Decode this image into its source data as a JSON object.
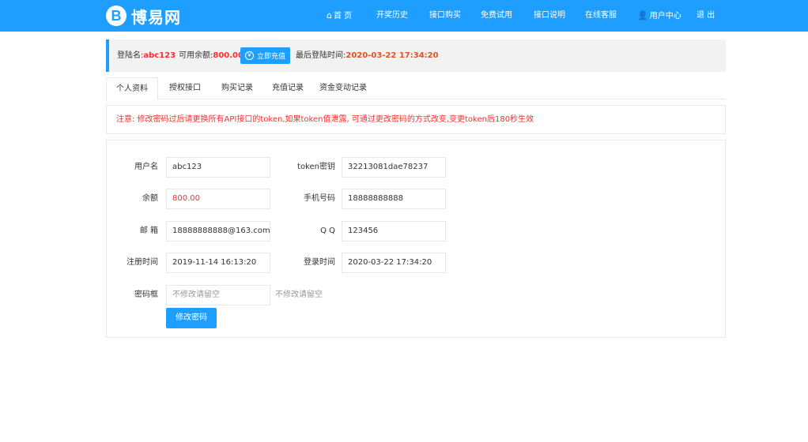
{
  "brand": {
    "logo_letter": "B",
    "name": "博易网",
    "color": "#1e9fff"
  },
  "nav": {
    "home": "首 页",
    "home_icon": "home-icon",
    "history": "开奖历史",
    "buy_api": "接口购买",
    "free_trial": "免费试用",
    "api_doc": "接口说明",
    "support": "在线客服",
    "user_center": "用户中心",
    "user_icon": "user-icon",
    "logout": "退 出"
  },
  "account_bar": {
    "username_label": "登陆名:",
    "username": "abc123",
    "balance_label": "可用余额:",
    "balance": "800.00",
    "recharge_icon": "yen-circle-icon",
    "recharge_label": "立即充值",
    "last_login_label": "最后登陆时间:",
    "last_login": "2020-03-22 17:34:20"
  },
  "tabs": [
    {
      "label": "个人资料",
      "active": true
    },
    {
      "label": "授权接口",
      "active": false
    },
    {
      "label": "购买记录",
      "active": false
    },
    {
      "label": "充值记录",
      "active": false
    },
    {
      "label": "资金变动记录",
      "active": false
    }
  ],
  "notice": "注意: 修改密码过后请更换所有API接口的token,如果token值泄露, 可通过更改密码的方式改变,变更token后180秒生效",
  "profile": {
    "username_label": "用户名",
    "username": "abc123",
    "token_label": "token密钥",
    "token": "32213081dae78237",
    "balance_label": "余额",
    "balance": "800.00",
    "phone_label": "手机号码",
    "phone": "18888888888",
    "email_label": "邮 箱",
    "email": "18888888888@163.com",
    "qq_label": "Q Q",
    "qq": "123456",
    "reg_time_label": "注册时间",
    "reg_time": "2019-11-14 16:13:20",
    "login_time_label": "登录时间",
    "login_time": "2020-03-22 17:34:20",
    "password_label": "密码框",
    "password_placeholder": "不修改请留空",
    "password_hint": "不修改请留空",
    "submit_label": "修改密码"
  }
}
